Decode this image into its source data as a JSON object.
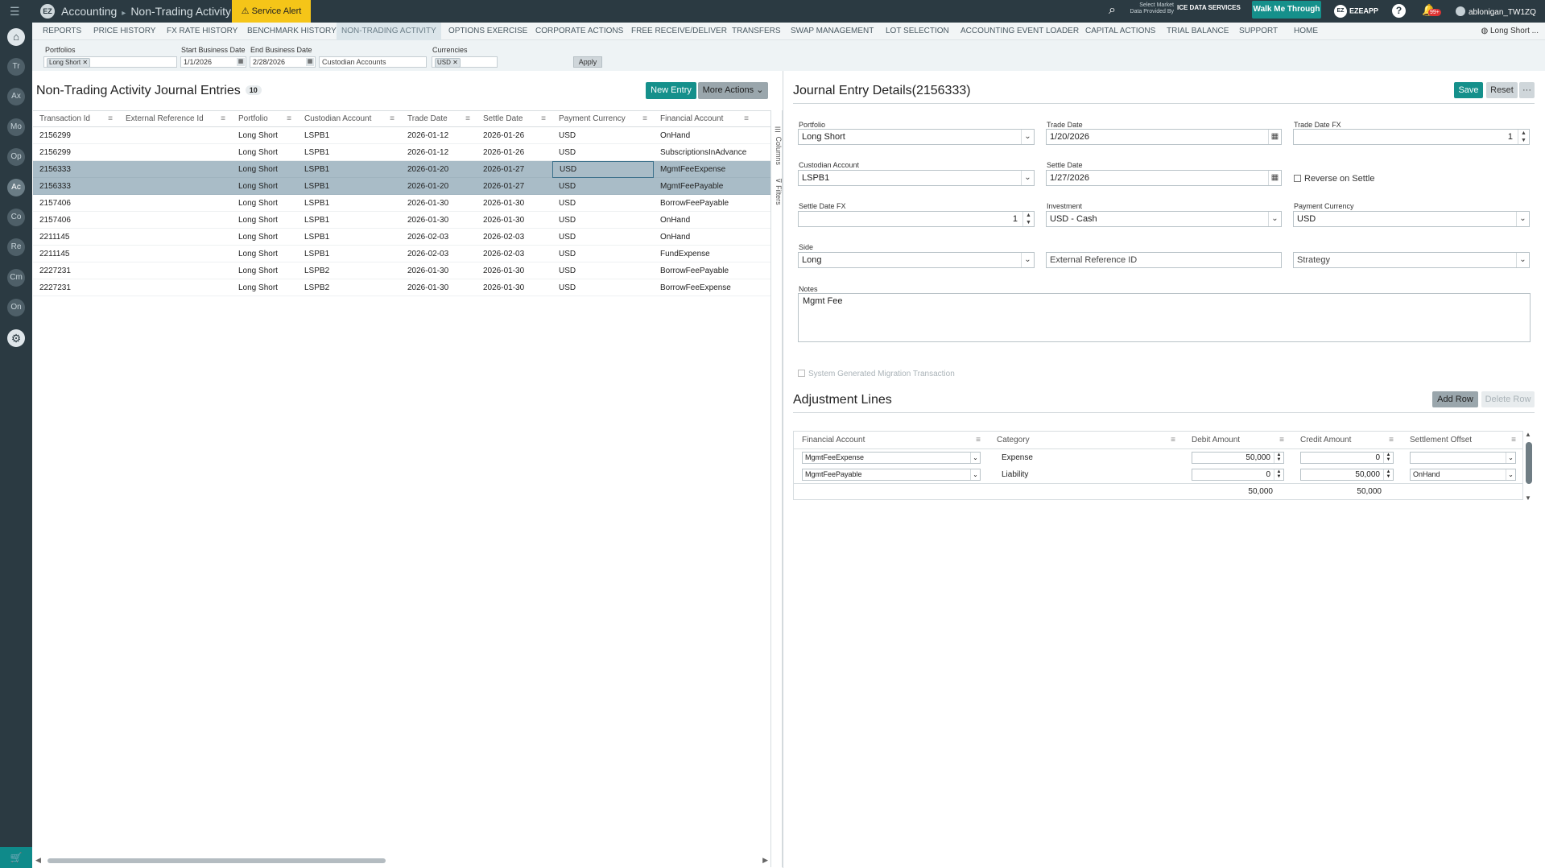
{
  "app": {
    "module": "Accounting",
    "page": "Non-Trading Activity",
    "service_alert": "Service Alert",
    "market_data_text": "Select Market Data Provided By",
    "market_data_provider": "ICE DATA SERVICES",
    "walk_me": "Walk Me Through",
    "ezeapp": "EZEAPP",
    "ezeapp_logo": "EZ",
    "notifications_badge": "99+",
    "user": "ablonigan_TW1ZQ",
    "context": "Long Short ..."
  },
  "rail": [
    "Tr",
    "Ax",
    "Mo",
    "Op",
    "Ac",
    "Co",
    "Re",
    "Cm",
    "On"
  ],
  "tabs": [
    "REPORTS",
    "PRICE HISTORY",
    "FX RATE HISTORY",
    "BENCHMARK HISTORY",
    "NON-TRADING ACTIVITY",
    "OPTIONS EXERCISE",
    "CORPORATE ACTIONS",
    "FREE RECEIVE/DELIVER",
    "TRANSFERS",
    "SWAP MANAGEMENT",
    "LOT SELECTION",
    "ACCOUNTING EVENT LOADER",
    "CAPITAL ACTIONS",
    "TRIAL BALANCE",
    "SUPPORT",
    "HOME"
  ],
  "filters": {
    "portfolios_label": "Portfolios",
    "portfolio_chip": "Long Short",
    "start_label": "Start Business Date",
    "start_value": "1/1/2026",
    "end_label": "End Business Date",
    "end_value": "2/28/2026",
    "custodian_placeholder": "Custodian Accounts",
    "currencies_label": "Currencies",
    "currency_chip": "USD",
    "apply": "Apply"
  },
  "left": {
    "title": "Non-Trading Activity Journal Entries",
    "count": "10",
    "new_entry": "New Entry",
    "more_actions": "More Actions",
    "side_columns": "Columns",
    "side_filters": "Filters",
    "columns": [
      "Transaction Id",
      "External Reference Id",
      "Portfolio",
      "Custodian Account",
      "Trade Date",
      "Settle Date",
      "Payment Currency",
      "Financial Account"
    ],
    "rows": [
      [
        "2156299",
        "",
        "Long Short",
        "LSPB1",
        "2026-01-12",
        "2026-01-26",
        "USD",
        "OnHand"
      ],
      [
        "2156299",
        "",
        "Long Short",
        "LSPB1",
        "2026-01-12",
        "2026-01-26",
        "USD",
        "SubscriptionsInAdvance"
      ],
      [
        "2156333",
        "",
        "Long Short",
        "LSPB1",
        "2026-01-20",
        "2026-01-27",
        "USD",
        "MgmtFeeExpense"
      ],
      [
        "2156333",
        "",
        "Long Short",
        "LSPB1",
        "2026-01-20",
        "2026-01-27",
        "USD",
        "MgmtFeePayable"
      ],
      [
        "2157406",
        "",
        "Long Short",
        "LSPB1",
        "2026-01-30",
        "2026-01-30",
        "USD",
        "BorrowFeePayable"
      ],
      [
        "2157406",
        "",
        "Long Short",
        "LSPB1",
        "2026-01-30",
        "2026-01-30",
        "USD",
        "OnHand"
      ],
      [
        "2211145",
        "",
        "Long Short",
        "LSPB1",
        "2026-02-03",
        "2026-02-03",
        "USD",
        "OnHand"
      ],
      [
        "2211145",
        "",
        "Long Short",
        "LSPB1",
        "2026-02-03",
        "2026-02-03",
        "USD",
        "FundExpense"
      ],
      [
        "2227231",
        "",
        "Long Short",
        "LSPB2",
        "2026-01-30",
        "2026-01-30",
        "USD",
        "BorrowFeePayable"
      ],
      [
        "2227231",
        "",
        "Long Short",
        "LSPB2",
        "2026-01-30",
        "2026-01-30",
        "USD",
        "BorrowFeeExpense"
      ]
    ],
    "selected_rows": [
      2,
      3
    ]
  },
  "right": {
    "title": "Journal Entry Details(2156333)",
    "save": "Save",
    "reset": "Reset",
    "more": "···",
    "portfolio_label": "Portfolio",
    "portfolio": "Long Short",
    "trade_date_label": "Trade Date",
    "trade_date": "1/20/2026",
    "trade_fx_label": "Trade Date FX",
    "trade_fx": "1",
    "custodian_label": "Custodian Account",
    "custodian": "LSPB1",
    "settle_date_label": "Settle Date",
    "settle_date": "1/27/2026",
    "reverse_label": "Reverse on Settle",
    "settle_fx_label": "Settle Date FX",
    "settle_fx": "1",
    "investment_label": "Investment",
    "investment": "USD - Cash",
    "pay_ccy_label": "Payment Currency",
    "pay_ccy": "USD",
    "side_label": "Side",
    "side": "Long",
    "ext_ref_placeholder": "External Reference ID",
    "strategy_placeholder": "Strategy",
    "notes_label": "Notes",
    "notes": "Mgmt Fee",
    "sys_gen": "System Generated Migration Transaction"
  },
  "adjustment": {
    "title": "Adjustment Lines",
    "add_row": "Add Row",
    "delete_row": "Delete Row",
    "columns": [
      "Financial Account",
      "Category",
      "Debit Amount",
      "Credit Amount",
      "Settlement Offset"
    ],
    "rows": [
      {
        "account": "MgmtFeeExpense",
        "category": "Expense",
        "debit": "50,000",
        "credit": "0",
        "offset": ""
      },
      {
        "account": "MgmtFeePayable",
        "category": "Liability",
        "debit": "0",
        "credit": "50,000",
        "offset": "OnHand"
      }
    ],
    "total_debit": "50,000",
    "total_credit": "50,000"
  }
}
